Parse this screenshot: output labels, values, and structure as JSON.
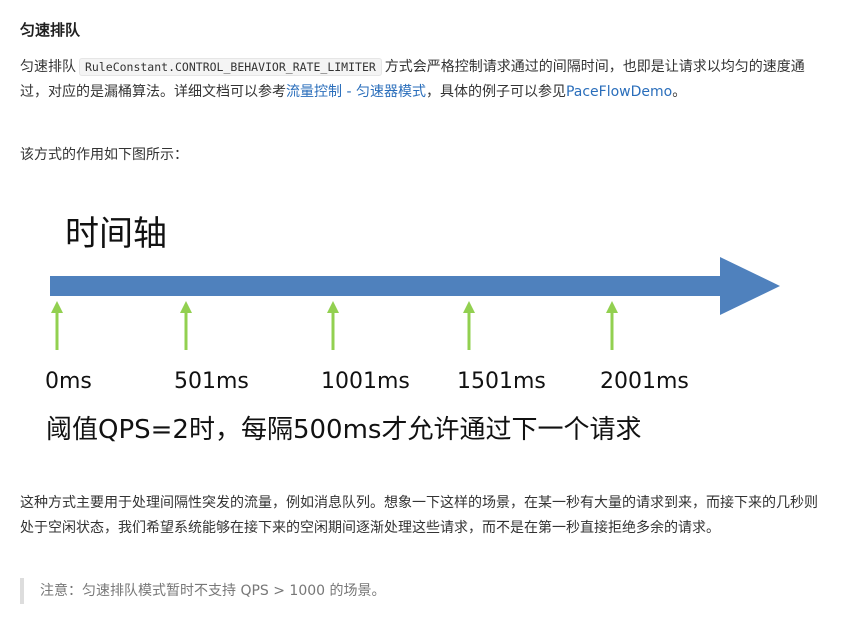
{
  "heading": "匀速排队",
  "p1": {
    "t1": "匀速排队",
    "code": "RuleConstant.CONTROL_BEHAVIOR_RATE_LIMITER",
    "t2": "方式会严格控制请求通过的间隔时间，也即是让请求以均匀的速度通过，对应的是漏桶算法。详细文档可以参考",
    "link1": "流量控制 - 匀速器模式",
    "t3": "，具体的例子可以参见",
    "link2": "PaceFlowDemo",
    "t4": "。"
  },
  "p2": "该方式的作用如下图所示：",
  "figure": {
    "title": "时间轴",
    "ticks": [
      "0ms",
      "501ms",
      "1001ms",
      "1501ms",
      "2001ms"
    ],
    "caption": "阈值QPS=2时，每隔500ms才允许通过下一个请求",
    "colors": {
      "axis": "#4f81bd",
      "arrow": "#92d050",
      "text": "#111111"
    }
  },
  "p3": "这种方式主要用于处理间隔性突发的流量，例如消息队列。想象一下这样的场景，在某一秒有大量的请求到来，而接下来的几秒则处于空闲状态，我们希望系统能够在接下来的空闲期间逐渐处理这些请求，而不是在第一秒直接拒绝多余的请求。",
  "note": "注意：匀速排队模式暂时不支持 QPS > 1000 的场景。"
}
